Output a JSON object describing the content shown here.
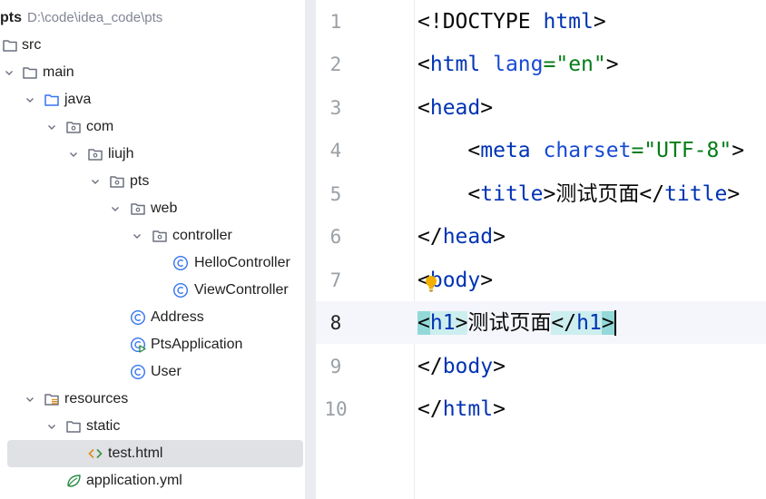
{
  "project": {
    "root_name": "pts",
    "root_path": "D:\\code\\idea_code\\pts",
    "items": [
      {
        "label": "src",
        "icon": "folder-icon"
      },
      {
        "label": "main",
        "icon": "folder-icon"
      },
      {
        "label": "java",
        "icon": "source-folder-icon"
      },
      {
        "label": "com",
        "icon": "package-icon"
      },
      {
        "label": "liujh",
        "icon": "package-icon"
      },
      {
        "label": "pts",
        "icon": "package-icon"
      },
      {
        "label": "web",
        "icon": "package-icon"
      },
      {
        "label": "controller",
        "icon": "package-icon"
      },
      {
        "label": "HelloController",
        "icon": "class-icon"
      },
      {
        "label": "ViewController",
        "icon": "class-icon"
      },
      {
        "label": "Address",
        "icon": "class-icon"
      },
      {
        "label": "PtsApplication",
        "icon": "spring-boot-app-icon"
      },
      {
        "label": "User",
        "icon": "class-icon"
      },
      {
        "label": "resources",
        "icon": "resources-folder-icon"
      },
      {
        "label": "static",
        "icon": "folder-icon"
      },
      {
        "label": "test.html",
        "icon": "html-file-icon"
      },
      {
        "label": "application.yml",
        "icon": "yaml-spring-icon"
      }
    ]
  },
  "editor": {
    "current_line": 8,
    "lines": [
      {
        "num": "1",
        "t": [
          "<!DOCTYPE ",
          "html",
          ">"
        ]
      },
      {
        "num": "2",
        "t": [
          "<",
          "html",
          " ",
          "lang",
          "=",
          "\"en\"",
          ">"
        ]
      },
      {
        "num": "3",
        "t": [
          "<",
          "head",
          ">"
        ]
      },
      {
        "num": "4",
        "t": [
          "    <",
          "meta",
          " ",
          "charset",
          "=",
          "\"UTF-8\"",
          ">"
        ]
      },
      {
        "num": "5",
        "t": [
          "    <",
          "title",
          ">",
          "测试页面",
          "</",
          "title",
          ">"
        ]
      },
      {
        "num": "6",
        "t": [
          "</",
          "head",
          ">"
        ]
      },
      {
        "num": "7",
        "t": [
          "<",
          "body",
          ">"
        ]
      },
      {
        "num": "8",
        "t": [
          "<",
          "h1",
          ">",
          "测试页面",
          "</",
          "h1",
          ">"
        ]
      },
      {
        "num": "9",
        "t": [
          "</",
          "body",
          ">"
        ]
      },
      {
        "num": "10",
        "t": [
          "</",
          "html",
          ">"
        ]
      }
    ]
  },
  "colors": {
    "tag": "#0033b3",
    "attribute": "#174ad4",
    "value": "#067d17",
    "bracket_highlight": "#93d9d9",
    "tag_highlight": "#cdeeee",
    "selected_row": "#dfe1e5",
    "current_line": "#f4f6fb"
  }
}
